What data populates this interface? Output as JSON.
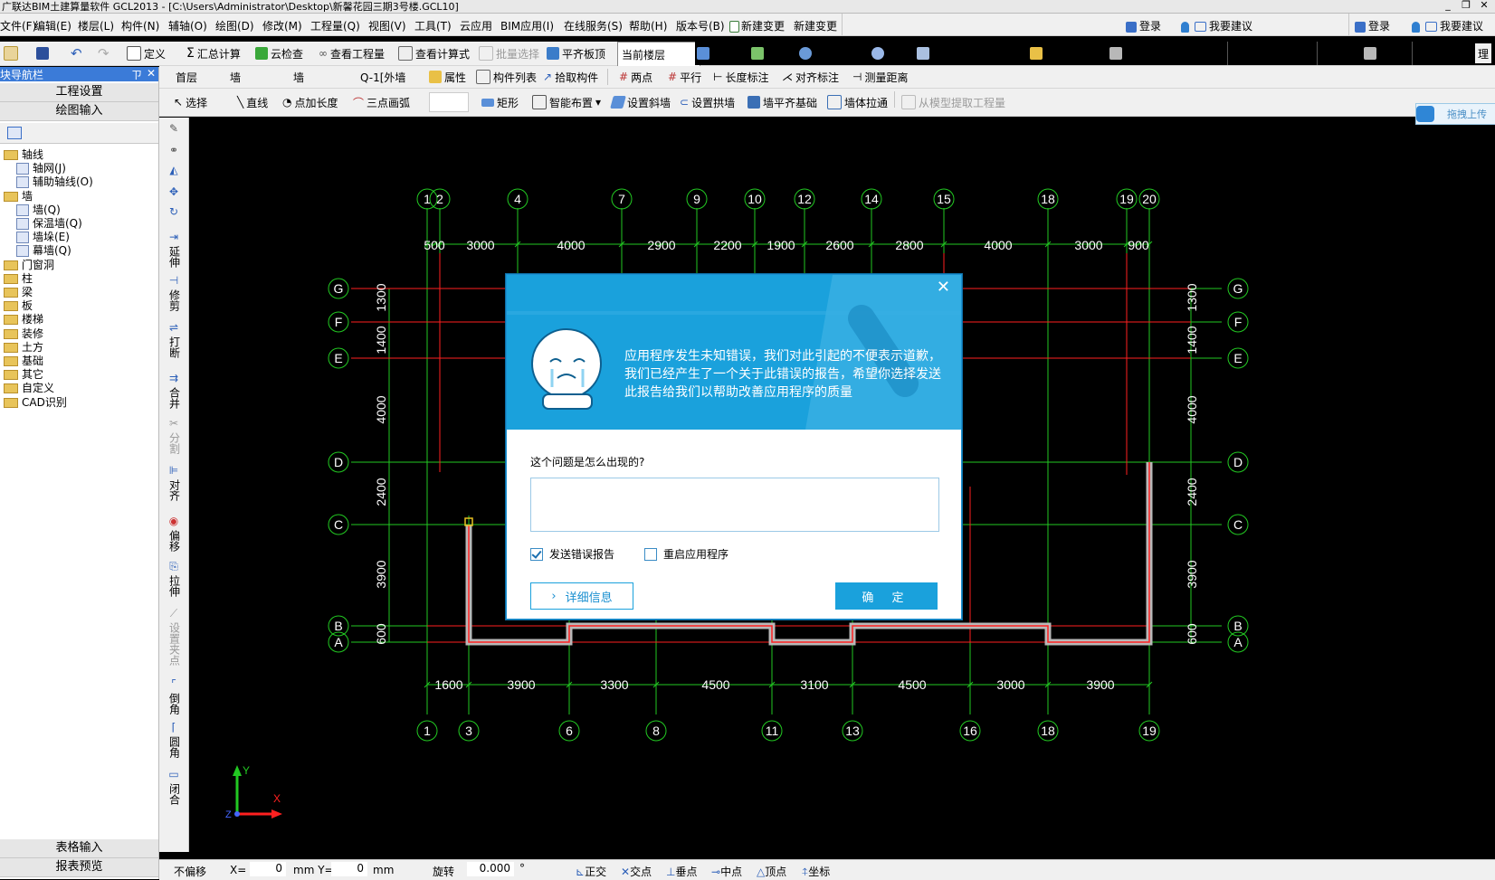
{
  "window": {
    "title": "广联达BIM土建算量软件 GCL2013 - [C:\\Users\\Administrator\\Desktop\\新馨花园三期3号楼.GCL10]",
    "minimize": "_",
    "restore": "❐",
    "close": "✕"
  },
  "menubar": {
    "items": [
      "文件(F)",
      "编辑(E)",
      "楼层(L)",
      "构件(N)",
      "辅轴(O)",
      "绘图(D)",
      "修改(M)",
      "工程量(Q)",
      "视图(V)",
      "工具(T)",
      "云应用",
      "BIM应用(I)",
      "在线服务(S)",
      "帮助(H)",
      "版本号(B)",
      "新建变更",
      "新建变更"
    ],
    "login1": "登录",
    "feedback1": "我要建议",
    "login2": "登录",
    "feedback2": "我要建议"
  },
  "toolbar1": {
    "define": "定义",
    "sum_calc": "汇总计算",
    "cloud_check": "云检查",
    "view_quantity": "查看工程量",
    "view_formula": "查看计算式",
    "batch_select": "批量选择",
    "level_floor": "平齐板顶",
    "floor_select": "当前楼层",
    "right_label": "理"
  },
  "toolbar2": {
    "floor": "首层",
    "category": "墙",
    "type": "墙",
    "component": "Q-1[外墙",
    "properties": "属性",
    "component_list": "构件列表",
    "pick_component": "拾取构件",
    "two_points": "两点",
    "parallel": "平行",
    "length_dim": "长度标注",
    "align_dim": "对齐标注",
    "measure": "测量距离"
  },
  "toolbar3": {
    "select": "选择",
    "line": "直线",
    "point_length": "点加长度",
    "three_point_arc": "三点画弧",
    "rectangle": "矩形",
    "smart_layout": "智能布置",
    "set_slope_wall": "设置斜墙",
    "set_arch_wall": "设置拱墙",
    "wall_align_found": "墙平齐基础",
    "wall_through": "墙体拉通",
    "extract_from_model": "从模型提取工程量",
    "cloud_upload": "拖拽上传"
  },
  "leftpanel": {
    "title": "模块导航栏",
    "pin": "ㄗ",
    "close": "✕",
    "project_settings": "工程设置",
    "drawing_input": "绘图输入",
    "tree": [
      {
        "label": "轴线",
        "level": 0
      },
      {
        "label": "轴网(J)",
        "level": 1
      },
      {
        "label": "辅助轴线(O)",
        "level": 1
      },
      {
        "label": "墙",
        "level": 0
      },
      {
        "label": "墙(Q)",
        "level": 1
      },
      {
        "label": "保温墙(Q)",
        "level": 1
      },
      {
        "label": "墙垛(E)",
        "level": 1
      },
      {
        "label": "幕墙(Q)",
        "level": 1
      },
      {
        "label": "门窗洞",
        "level": 0
      },
      {
        "label": "柱",
        "level": 0
      },
      {
        "label": "梁",
        "level": 0
      },
      {
        "label": "板",
        "level": 0
      },
      {
        "label": "楼梯",
        "level": 0
      },
      {
        "label": "装修",
        "level": 0
      },
      {
        "label": "土方",
        "level": 0
      },
      {
        "label": "基础",
        "level": 0
      },
      {
        "label": "其它",
        "level": 0
      },
      {
        "label": "自定义",
        "level": 0
      },
      {
        "label": "CAD识别",
        "level": 0
      }
    ],
    "table_input": "表格输入",
    "report_preview": "报表预览"
  },
  "vtools": [
    "延伸",
    "修剪",
    "打断",
    "合并",
    "分割",
    "对齐",
    "偏移",
    "拉伸",
    "设置夹点",
    "倒角",
    "圆角",
    "闭合"
  ],
  "statusbar": {
    "no_offset": "不偏移",
    "x_label": "X=",
    "x_value": "0",
    "unit_x": "mm Y=",
    "y_value": "0",
    "unit_y": "mm",
    "rotate": "旋转",
    "rotate_value": "0.000",
    "degree": "°",
    "snaps": [
      "正交",
      "交点",
      "垂点",
      "中点",
      "顶点",
      "坐标"
    ]
  },
  "drawing": {
    "top_axes": [
      "1",
      "2",
      "4",
      "7",
      "9",
      "10",
      "12",
      "14",
      "15",
      "18",
      "19",
      "20"
    ],
    "top_dims": [
      "500",
      "3000",
      "4000",
      "2900",
      "2200",
      "1900",
      "2600",
      "2800",
      "4000",
      "3000",
      "900"
    ],
    "bottom_axes": [
      "1",
      "3",
      "6",
      "8",
      "11",
      "13",
      "16",
      "18",
      "19"
    ],
    "bottom_dims": [
      "1600",
      "3900",
      "3300",
      "4500",
      "3100",
      "4500",
      "3000",
      "3900"
    ],
    "row_axes": [
      "G",
      "F",
      "E",
      "D",
      "C",
      "B",
      "A"
    ],
    "side_dims": [
      "1300",
      "1400",
      "4000",
      "2400",
      "3900",
      "600"
    ],
    "ucs": {
      "y": "Y",
      "x": "X",
      "z": "Z"
    }
  },
  "dialog": {
    "message": "应用程序发生未知错误，我们对此引起的不便表示道歉，我们已经产生了一个关于此错误的报告，希望你选择发送此报告给我们以帮助改善应用程序的质量",
    "question": "这个问题是怎么出现的?",
    "send_report": "发送错误报告",
    "send_report_checked": true,
    "restart_app": "重启应用程序",
    "restart_app_checked": false,
    "details_button": "详细信息",
    "ok_button": "确 定",
    "close": "✕"
  },
  "colors": {
    "accent": "#1aa1dc",
    "axis_green": "#22c822",
    "wall_red": "#ff2020",
    "canvas_bg": "#000000"
  }
}
